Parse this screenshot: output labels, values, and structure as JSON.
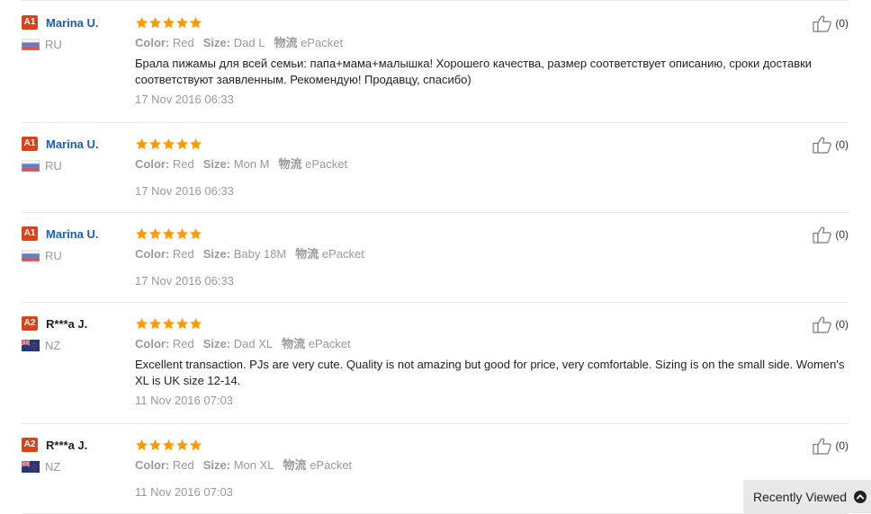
{
  "labels": {
    "color": "Color:",
    "size": "Size:",
    "shipping": "物流"
  },
  "reviews": [
    {
      "badge": "A1",
      "name": "Marina U.",
      "country": "RU",
      "flag": "russia",
      "rating": 5,
      "color": "Red",
      "size": "Dad L",
      "shipping": "ePacket",
      "text": "Брала пижамы для всей семьи: папа+мама+малышка! Хорошего качества, размер соответствует описанию, сроки доставки соответствуют заявленным. Рекомендую! Продавцу, спасибо)",
      "date": "17 Nov 2016 06:33",
      "helpful": "(0)"
    },
    {
      "badge": "A1",
      "name": "Marina U.",
      "country": "RU",
      "flag": "russia",
      "rating": 5,
      "color": "Red",
      "size": "Mon M",
      "shipping": "ePacket",
      "text": "",
      "date": "17 Nov 2016 06:33",
      "helpful": "(0)"
    },
    {
      "badge": "A1",
      "name": "Marina U.",
      "country": "RU",
      "flag": "russia",
      "rating": 5,
      "color": "Red",
      "size": "Baby 18M",
      "shipping": "ePacket",
      "text": "",
      "date": "17 Nov 2016 06:33",
      "helpful": "(0)"
    },
    {
      "badge": "A2",
      "name": "R***a J.",
      "country": "NZ",
      "flag": "new-zealand",
      "rating": 5,
      "color": "Red",
      "size": "Dad XL",
      "shipping": "ePacket",
      "text": "Excellent transaction. PJs are very cute. Quality is not amazing but good for price, very comfortable. Sizing is on the small side. Women's XL is UK size 12-14.",
      "date": "11 Nov 2016 07:03",
      "helpful": "(0)"
    },
    {
      "badge": "A2",
      "name": "R***a J.",
      "country": "NZ",
      "flag": "new-zealand",
      "rating": 5,
      "color": "Red",
      "size": "Mon XL",
      "shipping": "ePacket",
      "text": "",
      "date": "11 Nov 2016 07:03",
      "helpful": "(0)"
    }
  ],
  "recently_viewed": {
    "label": "Recently Viewed",
    "icon": "chevron-up-icon"
  },
  "colors": {
    "badge": "#d9431b",
    "star": "#ff9a00",
    "link": "#1a5fb4"
  }
}
